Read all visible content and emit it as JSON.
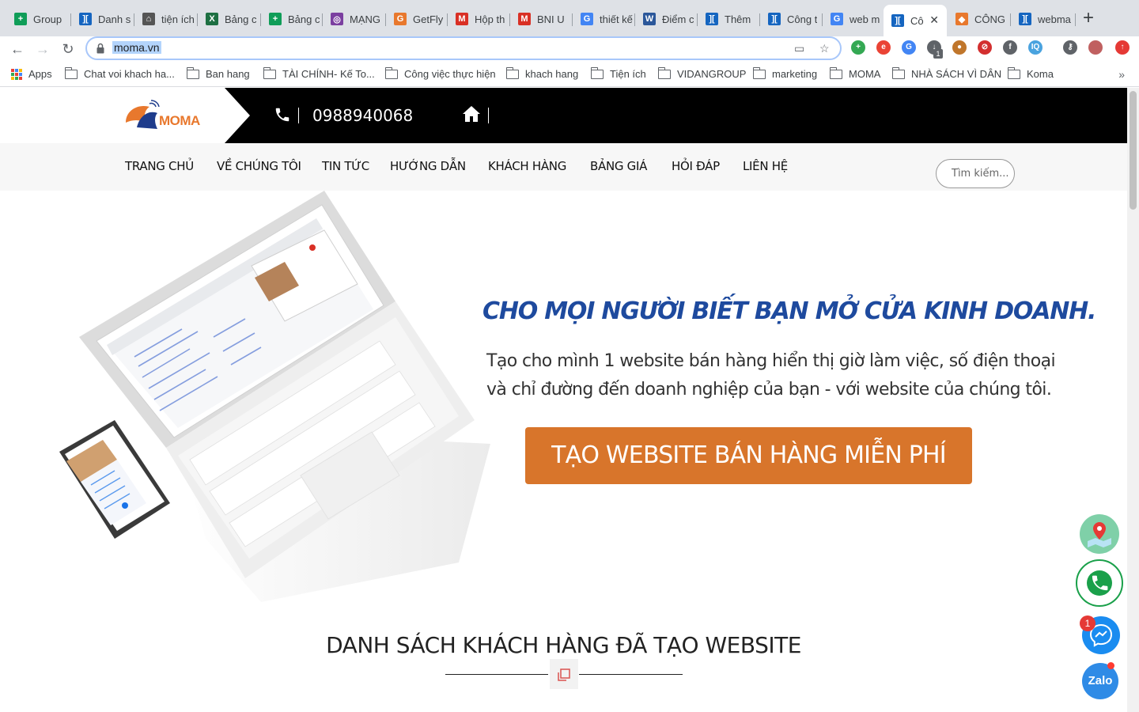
{
  "tabs": [
    {
      "label": "Group",
      "icon": "google-sheets-icon",
      "color": "#0f9d58",
      "glyph": "+"
    },
    {
      "label": "Danh s",
      "icon": "getfly-icon",
      "color": "#1565c0",
      "glyph": "]["
    },
    {
      "label": "tiện ích",
      "icon": "lock-icon",
      "color": "#555555",
      "glyph": "⌂"
    },
    {
      "label": "Bảng c",
      "icon": "excel-icon",
      "color": "#1d6f42",
      "glyph": "X"
    },
    {
      "label": "Bảng c",
      "icon": "google-sheets-icon",
      "color": "#0f9d58",
      "glyph": "+"
    },
    {
      "label": "MẠNG",
      "icon": "network-icon",
      "color": "#7b3fa0",
      "glyph": "◎"
    },
    {
      "label": "GetFly",
      "icon": "getfly-g-icon",
      "color": "#e8782d",
      "glyph": "G"
    },
    {
      "label": "Hộp th",
      "icon": "gmail-icon",
      "color": "#d93025",
      "glyph": "M"
    },
    {
      "label": "BNI U",
      "icon": "gmail-icon",
      "color": "#d93025",
      "glyph": "M"
    },
    {
      "label": "thiết kế",
      "icon": "google-icon",
      "color": "#4285f4",
      "glyph": "G"
    },
    {
      "label": "Điểm c",
      "icon": "word-icon",
      "color": "#2b579a",
      "glyph": "W"
    },
    {
      "label": "Thêm",
      "icon": "getfly-icon",
      "color": "#1565c0",
      "glyph": "]["
    },
    {
      "label": "Công t",
      "icon": "getfly-icon",
      "color": "#1565c0",
      "glyph": "]["
    },
    {
      "label": "web m",
      "icon": "google-icon",
      "color": "#4285f4",
      "glyph": "G"
    },
    {
      "label": "Cô",
      "icon": "getfly-icon",
      "color": "#1565c0",
      "glyph": "]["
    },
    {
      "label": "CÔNG",
      "icon": "moma-icon",
      "color": "#e8782d",
      "glyph": "◆"
    },
    {
      "label": "webma",
      "icon": "getfly-icon",
      "color": "#1565c0",
      "glyph": "]["
    }
  ],
  "omnibox": {
    "url": "moma.vn"
  },
  "extensions": [
    {
      "icon": "plus-extension-icon",
      "color": "#34a853",
      "glyph": "+"
    },
    {
      "icon": "circle-extension-icon",
      "color": "#ea4335",
      "glyph": "e"
    },
    {
      "icon": "translate-icon",
      "color": "#4285f4",
      "glyph": "G"
    },
    {
      "icon": "download-icon",
      "color": "#5f6368",
      "glyph": "↓",
      "badge": "1"
    },
    {
      "icon": "cookie-icon",
      "color": "#c0762b",
      "glyph": "●"
    },
    {
      "icon": "block-icon",
      "color": "#d32f2f",
      "glyph": "⊘"
    },
    {
      "icon": "facebook-icon",
      "color": "#5f6368",
      "glyph": "f"
    },
    {
      "icon": "iq-icon",
      "color": "#4aa3df",
      "glyph": "IQ"
    },
    {
      "icon": "key-icon",
      "color": "#5f6368",
      "glyph": "⚷"
    },
    {
      "icon": "avatar",
      "color": "#c06060",
      "glyph": ""
    },
    {
      "icon": "update-icon",
      "color": "#e53935",
      "glyph": "↑"
    }
  ],
  "bookmarks": {
    "apps_label": "Apps",
    "items": [
      "Chat voi khach ha...",
      "Ban hang",
      "TÀI CHÍNH- Kế To...",
      "Công việc thực hiện",
      "khach hang",
      "Tiện ích",
      "VIDANGROUP",
      "marketing",
      "MOMA",
      "NHÀ SÁCH VÌ DÂN",
      "Koma"
    ],
    "more": "»"
  },
  "site": {
    "logo_text": "MOMA",
    "phone": "0988940068",
    "nav": [
      "TRANG CHỦ",
      "VỀ CHÚNG TÔI",
      "TIN TỨC",
      "HƯỚNG DẪN",
      "KHÁCH HÀNG",
      "BẢNG GIÁ",
      "HỎI ĐÁP",
      "LIÊN HỆ"
    ],
    "search_placeholder": "Tìm kiếm...",
    "hero_title": "CHO MỌI NGƯỜI BIẾT BẠN MỞ CỬA KINH DOANH.",
    "hero_sub_line1": "Tạo cho mình 1 website bán hàng hiển thị giờ làm việc, số điện thoại",
    "hero_sub_line2": "và chỉ đường đến doanh nghiệp của bạn - với website của chúng tôi.",
    "cta": "TẠO WEBSITE BÁN HÀNG MIỄN PHÍ",
    "section_title": "DANH SÁCH KHÁCH HÀNG ĐÃ TẠO WEBSITE",
    "messenger_badge": "1",
    "zalo_label": "Zalo"
  },
  "colors": {
    "brand_orange": "#d8752b",
    "hero_blue": "#1e4a9e",
    "topbar": "#000000"
  }
}
